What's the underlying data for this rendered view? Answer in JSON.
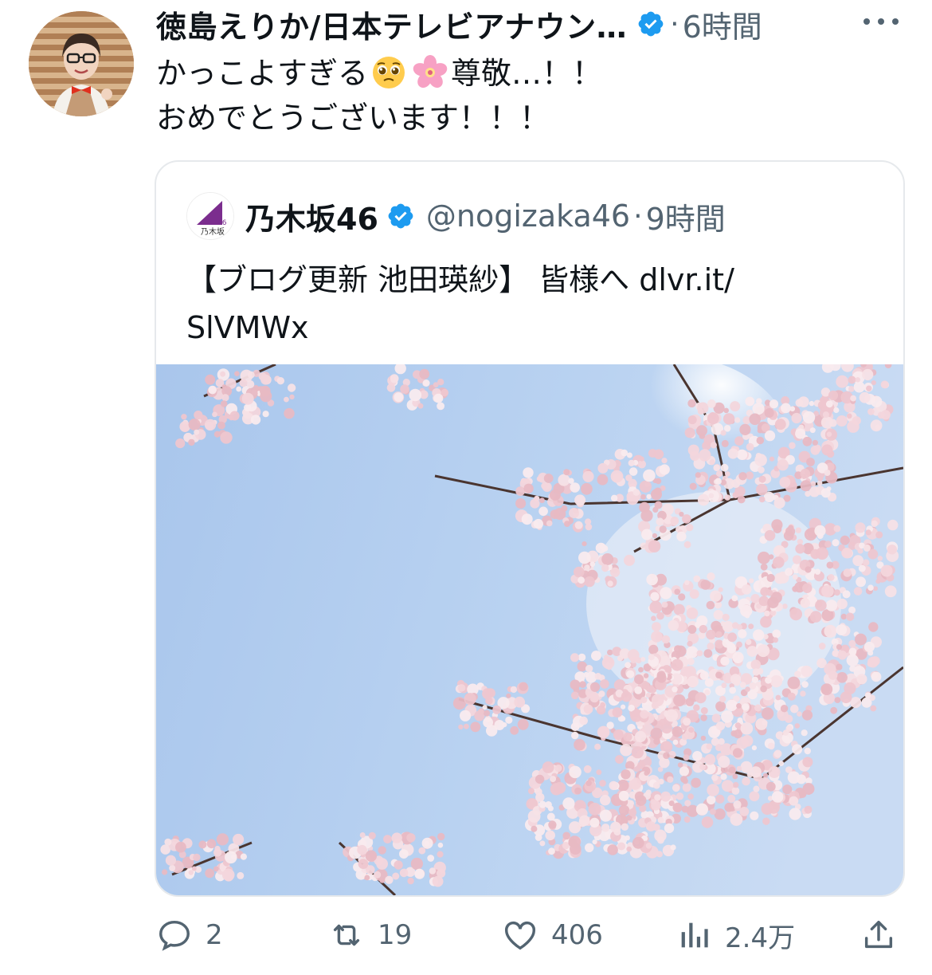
{
  "tweet": {
    "author_name": "徳島えりか/日本テレビアナウン…",
    "separator": "·",
    "time": "6時間",
    "text_line1_a": "かっこよすぎる",
    "text_line1_b": "尊敬…！！",
    "text_line2": "おめでとうございます！！！",
    "emoji_1": "pleading-face-emoji",
    "emoji_2": "cherry-blossom-emoji"
  },
  "quote": {
    "author_name": "乃木坂46",
    "handle": "@nogizaka46",
    "separator": "·",
    "time": "9時間",
    "text_line1": "【ブログ更新 池田瑛紗】 皆様へ dlvr.it/",
    "text_line2": "SlVMWx",
    "avatar_text_num": "46",
    "avatar_text_jp": "乃木坂",
    "image_subject": "cherry-blossoms-against-blue-sky"
  },
  "actions": {
    "reply_count": "2",
    "retweet_count": "19",
    "like_count": "406",
    "views_count": "2.4万"
  },
  "colors": {
    "verified": "#1d9bf0",
    "muted_text": "#536471",
    "nogizaka_purple": "#7b2d8e"
  }
}
